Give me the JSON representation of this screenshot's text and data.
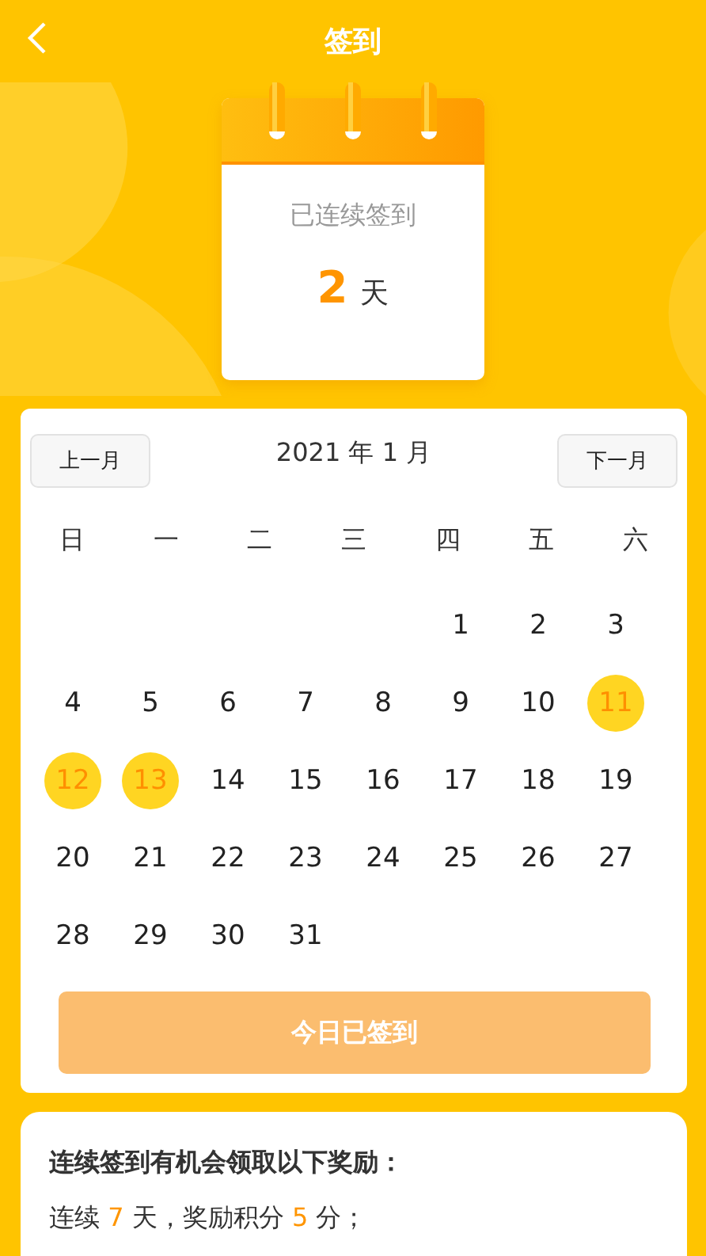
{
  "header": {
    "title": "签到"
  },
  "streak": {
    "label": "已连续签到",
    "count": "2",
    "unit": "天"
  },
  "calendar": {
    "prev": "上一月",
    "month": "2021 年 1 月",
    "next": "下一月",
    "weekdays": [
      "日",
      "一",
      "二",
      "三",
      "四",
      "五",
      "六"
    ],
    "weeks": [
      {
        "days": [
          {
            "label": "1",
            "signed": false
          },
          {
            "label": "2",
            "signed": false
          },
          {
            "label": "3",
            "signed": false
          }
        ]
      },
      {
        "days": [
          {
            "label": "4",
            "signed": false
          },
          {
            "label": "5",
            "signed": false
          },
          {
            "label": "6",
            "signed": false
          },
          {
            "label": "7",
            "signed": false
          },
          {
            "label": "8",
            "signed": false
          },
          {
            "label": "9",
            "signed": false
          },
          {
            "label": "10",
            "signed": false
          },
          {
            "label": "11",
            "signed": true
          }
        ]
      },
      {
        "days": [
          {
            "label": "12",
            "signed": true
          },
          {
            "label": "13",
            "signed": true
          },
          {
            "label": "14",
            "signed": false
          },
          {
            "label": "15",
            "signed": false
          },
          {
            "label": "16",
            "signed": false
          },
          {
            "label": "17",
            "signed": false
          },
          {
            "label": "18",
            "signed": false
          },
          {
            "label": "19",
            "signed": false
          }
        ]
      },
      {
        "days": [
          {
            "label": "20",
            "signed": false
          },
          {
            "label": "21",
            "signed": false
          },
          {
            "label": "22",
            "signed": false
          },
          {
            "label": "23",
            "signed": false
          },
          {
            "label": "24",
            "signed": false
          },
          {
            "label": "25",
            "signed": false
          },
          {
            "label": "26",
            "signed": false
          },
          {
            "label": "27",
            "signed": false
          }
        ]
      },
      {
        "days": [
          {
            "label": "28",
            "signed": false
          },
          {
            "label": "29",
            "signed": false
          },
          {
            "label": "30",
            "signed": false
          },
          {
            "label": "31",
            "signed": false
          }
        ]
      }
    ],
    "button": {
      "label": "今日已签到",
      "disabled": true
    }
  },
  "rewards": {
    "title": "连续签到有机会领取以下奖励：",
    "lines": [
      [
        {
          "text": "连续 ",
          "highlight": false
        },
        {
          "text": "7",
          "highlight": true
        },
        {
          "text": " 天，奖励积分 ",
          "highlight": false
        },
        {
          "text": "5",
          "highlight": true
        },
        {
          "text": " 分；",
          "highlight": false
        }
      ]
    ]
  }
}
